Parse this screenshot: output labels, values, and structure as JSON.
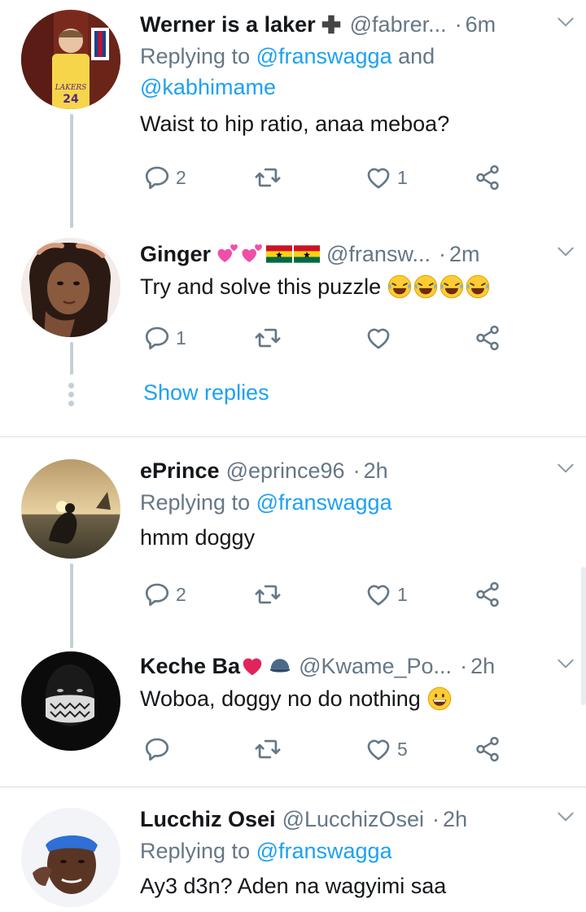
{
  "tweets": [
    {
      "name": "Werner is a laker",
      "handle": "@fabrer...",
      "time": "6m",
      "replying_prefix": "Replying to ",
      "replying_1": "@franswagga",
      "replying_and": " and",
      "replying_2": "@kabhimame",
      "text": "Waist to hip ratio, anaa meboa?",
      "replies": "2",
      "retweets": "",
      "likes": "1"
    },
    {
      "name": "Ginger",
      "handle": "@fransw...",
      "time": "2m",
      "text": "Try and solve this puzzle",
      "replies": "1",
      "retweets": "",
      "likes": ""
    },
    {
      "name": "ePrince",
      "handle": "@eprince96",
      "time": "2h",
      "replying_prefix": "Replying to ",
      "replying_1": "@franswagga",
      "text": "hmm doggy",
      "replies": "2",
      "retweets": "",
      "likes": "1"
    },
    {
      "name": "Keche Ba",
      "handle": "@Kwame_Po...",
      "time": "2h",
      "text": "Woboa, doggy no do nothing",
      "replies": "",
      "retweets": "",
      "likes": "5"
    },
    {
      "name": "Lucchiz Osei",
      "handle": "@LucchizOsei",
      "time": "2h",
      "replying_prefix": "Replying to ",
      "replying_1": "@franswagga",
      "text": "Ay3 d3n? Aden na wagyimi saa"
    }
  ],
  "show_replies": "Show replies",
  "separator_dot": "·",
  "colors": {
    "link": "#1da1f2",
    "muted": "#657786",
    "heart_red": "#e0245e",
    "divider": "#d8dee3"
  },
  "icons": [
    "reply-icon",
    "retweet-icon",
    "like-icon",
    "share-icon",
    "chevron-down-icon",
    "red-cross-emoji",
    "pink-hearts-emoji",
    "ghana-flag-emoji",
    "laughing-emoji",
    "red-heart-emoji",
    "cap-emoji",
    "grinning-emoji"
  ]
}
